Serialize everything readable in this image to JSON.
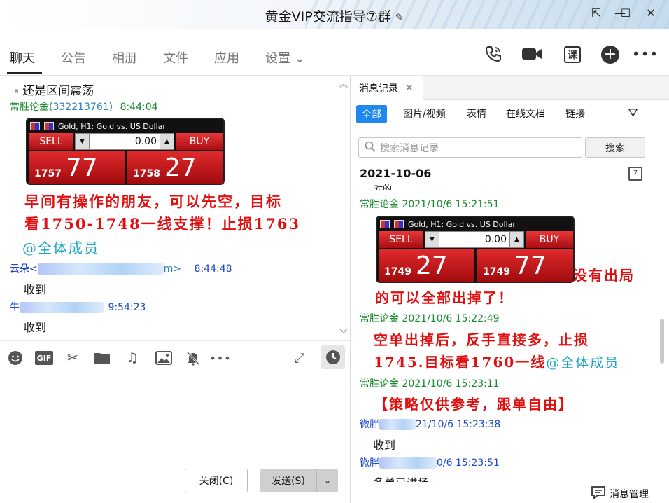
{
  "window": {
    "title": "黄金VIP交流指导⑦群",
    "edit_icon": "pencil-icon",
    "controls": [
      "pin-icon",
      "minimize-icon",
      "maximize-icon",
      "close-icon"
    ]
  },
  "tabs": [
    {
      "label": "聊天",
      "active": true
    },
    {
      "label": "公告"
    },
    {
      "label": "相册"
    },
    {
      "label": "文件"
    },
    {
      "label": "应用"
    },
    {
      "label": "设置 ⌄"
    }
  ],
  "top_actions": [
    "voice-call-icon",
    "video-call-icon",
    "lesson-icon",
    "add-icon",
    "more-icon"
  ],
  "lesson_label": "课",
  "chat": {
    "partial_line": "还是区间震荡",
    "msg1": {
      "sender": "常胜论金(",
      "qq": "332213761",
      "sender_end": ")",
      "time": "8:44:04",
      "widget": {
        "symbol_text": "Gold, H1:  Gold vs. US Dollar",
        "sell_label": "SELL",
        "buy_label": "BUY",
        "lot_value": "0.00",
        "sell_small": "1757",
        "sell_big": "77",
        "buy_small": "1758",
        "buy_big": "27"
      },
      "line1": "早间有操作的朋友，可以先空，目标",
      "line2": "看1750-1748一线支撑！止损1763",
      "mention": "@全体成员"
    },
    "msg2": {
      "sender": "云朵<",
      "sender_end": "m>",
      "time": "8:44:48",
      "text": "收到"
    },
    "msg3": {
      "sender": "牛",
      "time": "9:54:23",
      "text": "收到"
    }
  },
  "composer": {
    "icons": [
      "emoji-icon",
      "gif-icon",
      "scissors-icon",
      "folder-icon",
      "music-icon",
      "image-icon",
      "mute-bell-icon",
      "more-icon"
    ],
    "gif_label": "GIF",
    "close_label": "关闭(C)",
    "send_label": "发送(S)"
  },
  "history": {
    "tab_label": "消息记录",
    "filters": [
      "全部",
      "图片/视频",
      "表情",
      "在线文档",
      "链接"
    ],
    "search_placeholder": "搜索消息记录",
    "search_button": "搜索",
    "date": "2021-10-06",
    "calendar_day": "7",
    "cut_top": "对的",
    "entries": {
      "e1_meta": "常胜论金 2021/10/6 15:21:51",
      "e1_widget": {
        "symbol_text": "Gold, H1:  Gold vs. US Dollar",
        "sell_label": "SELL",
        "buy_label": "BUY",
        "lot_value": "0.00",
        "sell_small": "1749",
        "sell_big": "27",
        "buy_small": "1749",
        "buy_big": "77"
      },
      "e1_side": "没有出局",
      "e1_line2": "的可以全部出掉了！",
      "e2_meta": "常胜论金 2021/10/6 15:22:49",
      "e2_line1": "空单出掉后，反手直接多，止损",
      "e2_line2": "1745.目标看1760一线",
      "e2_mention": "@全体成员",
      "e3_meta": "常胜论金 2021/10/6 15:23:11",
      "e3_text": "【策略仅供参考，跟单自由】",
      "e4_sender": "微胖",
      "e4_meta_end": "21/10/6 15:23:38",
      "e4_text": "收到",
      "e5_sender": "微胖",
      "e5_meta_end": "0/6 15:23:51",
      "e5_text": "多单已进场"
    },
    "footer_label": "消息管理"
  }
}
